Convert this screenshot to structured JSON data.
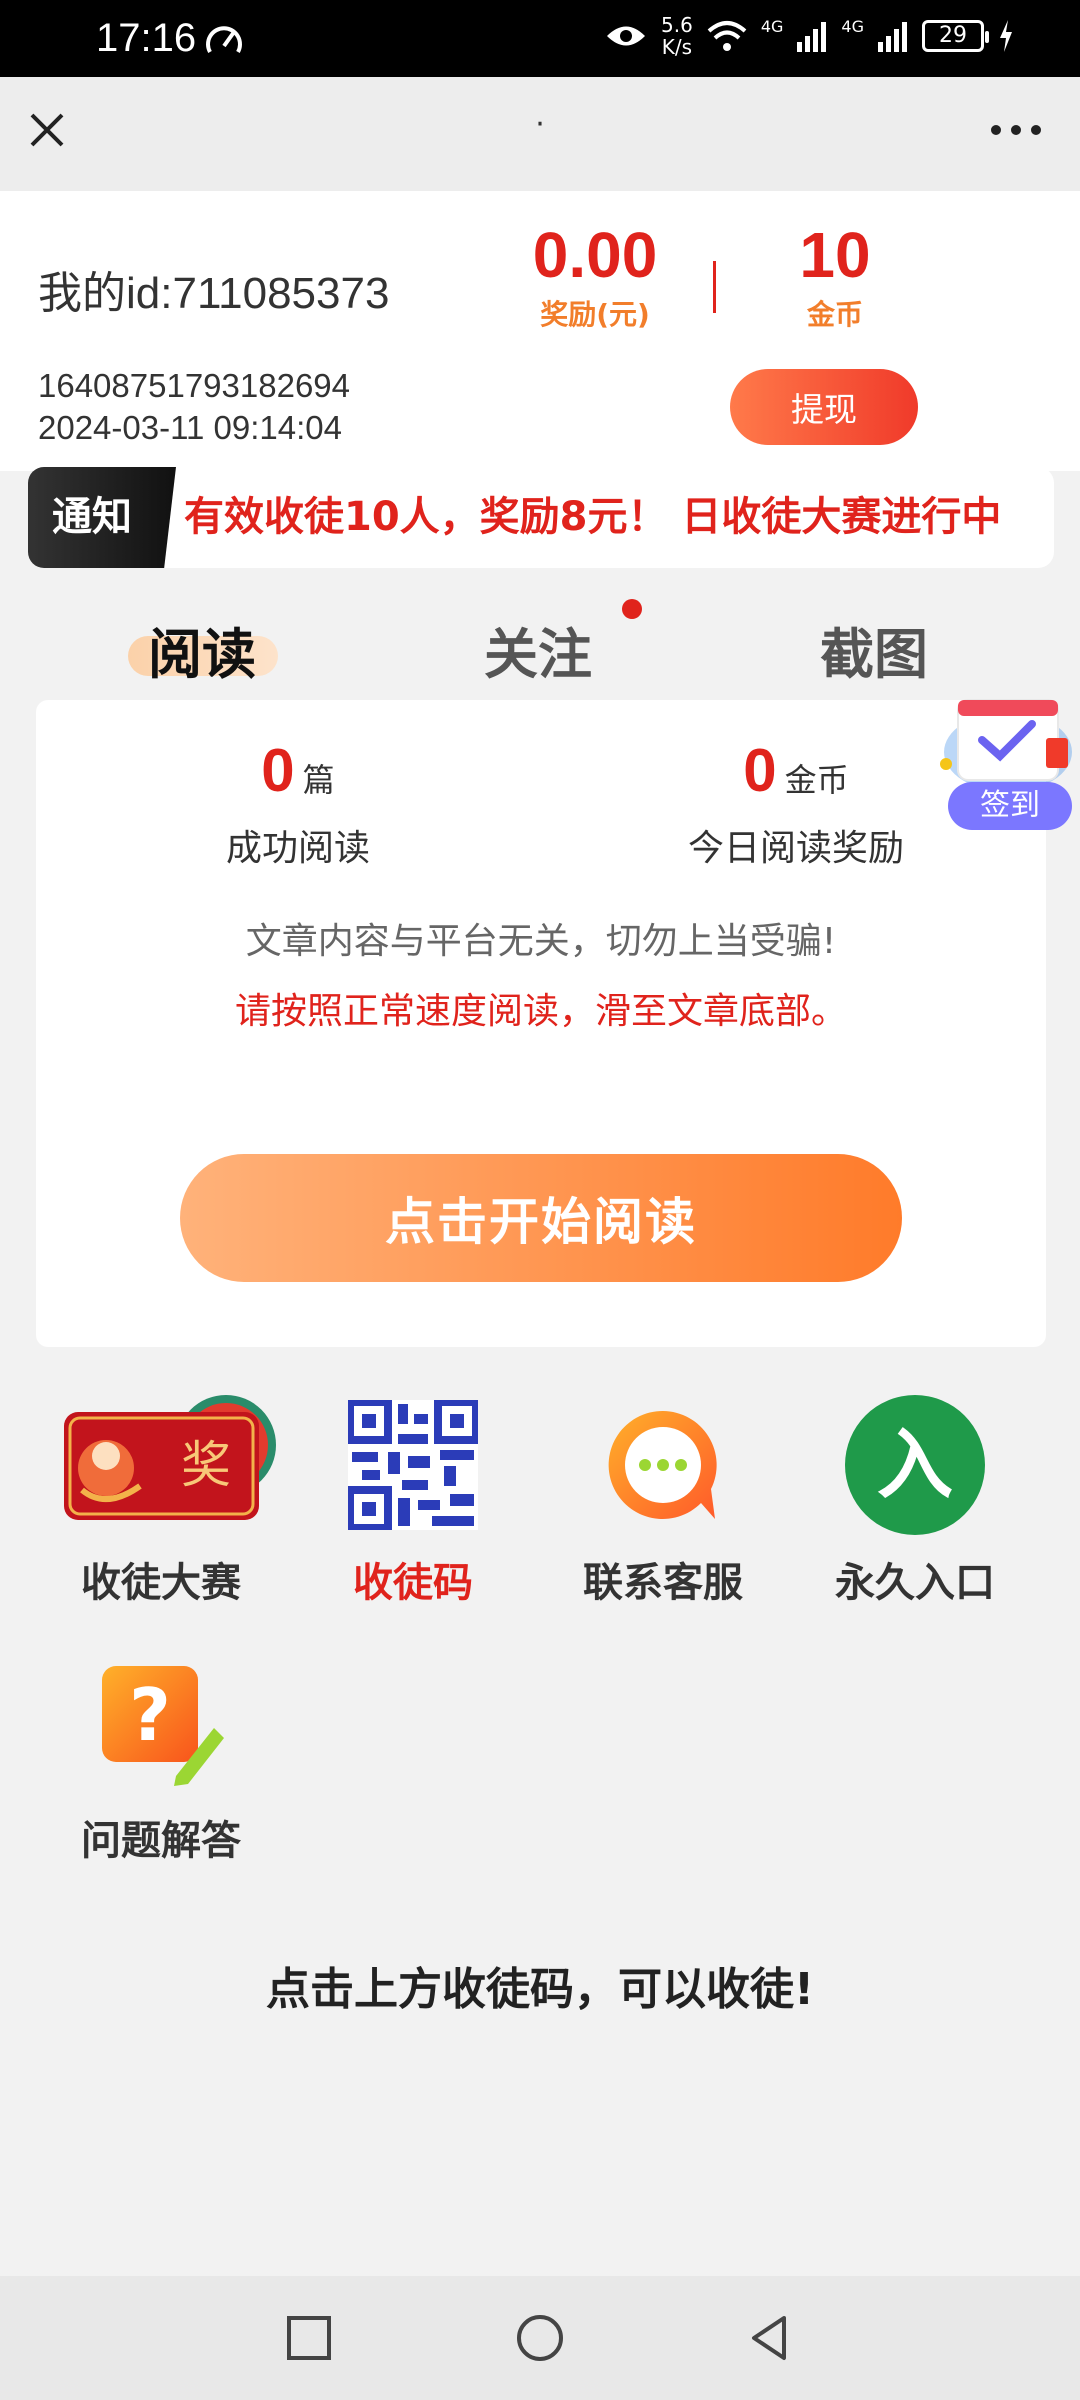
{
  "status_bar": {
    "time": "17:16",
    "net_speed_value": "5.6",
    "net_speed_unit": "K/s",
    "network_1": "4G",
    "network_2": "4G",
    "battery": "29"
  },
  "title_bar": {
    "title": "·",
    "close_icon": "close-icon",
    "more_icon": "more-icon"
  },
  "header": {
    "my_id": "我的id:711085373",
    "reward_value": "0.00",
    "reward_label": "奖励(元)",
    "coins_value": "10",
    "coins_label": "金币",
    "account_code": "16408751793182694",
    "datetime": "2024-03-11 09:14:04",
    "withdraw_label": "提现"
  },
  "notice": {
    "tag": "通知",
    "text": "有效收徒10人，奖励8元！ 日收徒大赛进行中"
  },
  "tabs": [
    {
      "label": "阅读",
      "active": true
    },
    {
      "label": "关注",
      "active": false,
      "has_dot": true
    },
    {
      "label": "截图",
      "active": false
    }
  ],
  "read_card": {
    "articles_count": "0",
    "articles_unit": "篇",
    "articles_label": "成功阅读",
    "coins_count": "0",
    "coins_unit": "金币",
    "coins_label": "今日阅读奖励",
    "disclaimer": "文章内容与平台无关，切勿上当受骗!",
    "warning": "请按照正常速度阅读，滑至文章底部。",
    "start_button": "点击开始阅读"
  },
  "sign_in": {
    "label": "签到"
  },
  "features": [
    {
      "label": "收徒大赛",
      "icon": "prize-icon",
      "highlight": false,
      "badge_text": "奖"
    },
    {
      "label": "收徒码",
      "icon": "qr-code-icon",
      "highlight": true
    },
    {
      "label": "联系客服",
      "icon": "chat-icon",
      "highlight": false
    },
    {
      "label": "永久入口",
      "icon": "entrance-icon",
      "highlight": false,
      "badge_text": "入"
    },
    {
      "label": "问题解答",
      "icon": "question-icon",
      "highlight": false,
      "badge_text": "?"
    }
  ],
  "invite_tip": "点击上方收徒码，可以收徒!",
  "colors": {
    "accent_red": "#e0231c",
    "accent_orange": "#ff7b2a",
    "label_orange": "#f27e2b"
  }
}
